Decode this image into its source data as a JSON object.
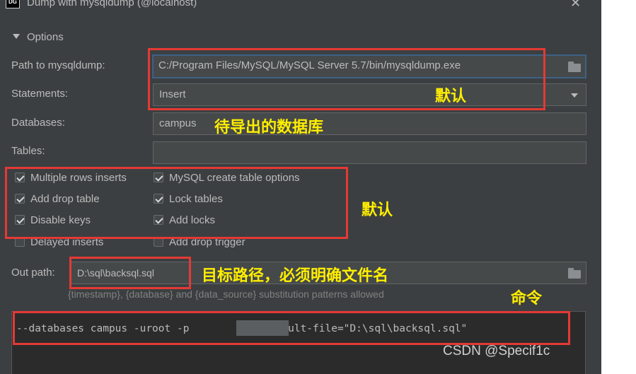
{
  "window": {
    "title": "Dump with mysqldump (@localhost)",
    "app_icon": "DG",
    "close_glyph": "✕"
  },
  "options": {
    "section_label": "Options",
    "path_label": "Path to mysqldump:",
    "path_value": "C:/Program Files/MySQL/MySQL Server 5.7/bin/mysqldump.exe",
    "statements_label": "Statements:",
    "statements_value": "Insert",
    "databases_label": "Databases:",
    "databases_value": "campus",
    "tables_label": "Tables:",
    "tables_value": ""
  },
  "checkboxes": {
    "multiple_rows_inserts": {
      "label": "Multiple rows inserts",
      "checked": true
    },
    "mysql_create_table_options": {
      "label": "MySQL create table options",
      "checked": true
    },
    "add_drop_table": {
      "label": "Add drop table",
      "checked": true
    },
    "lock_tables": {
      "label": "Lock tables",
      "checked": true
    },
    "disable_keys": {
      "label": "Disable keys",
      "checked": true
    },
    "add_locks": {
      "label": "Add locks",
      "checked": true
    },
    "delayed_inserts": {
      "label": "Delayed inserts",
      "checked": false
    },
    "add_drop_trigger": {
      "label": "Add drop trigger",
      "checked": false
    }
  },
  "out_path": {
    "label": "Out path:",
    "value": "D:\\sql\\backsql.sql",
    "hint": "{timestamp}, {database} and {data_source} substitution patterns allowed"
  },
  "command": {
    "text": "--databases campus -uroot -p           --result-file=\"D:\\sql\\backsql.sql\""
  },
  "annotations": {
    "default_1": "默认",
    "database_to_export": "待导出的数据库",
    "default_2": "默认",
    "target_path": "目标路径，必须明确文件名",
    "command": "命令"
  },
  "watermark": "CSDN @Specif1c",
  "colors": {
    "background": "#3c3f41",
    "annotation_box": "#e53935",
    "annotation_text": "#ffee00"
  }
}
